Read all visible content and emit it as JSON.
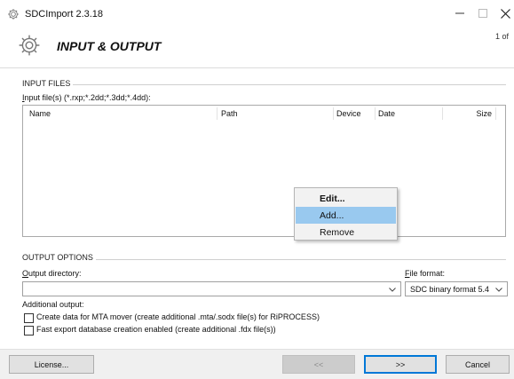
{
  "window": {
    "title": "SDCImport 2.3.18",
    "app_icon": "gear-icon",
    "controls": {
      "minimize_icon": "minimize-icon",
      "maximize_icon": "maximize-icon",
      "close_icon": "close-icon"
    }
  },
  "header": {
    "title": "INPUT & OUTPUT",
    "page_indicator": "1 of",
    "icon": "gear-icon"
  },
  "input_files": {
    "group_label": "INPUT FILES",
    "field_label": "Input file(s) (*.rxp;*.2dd;*.3dd;*.4dd):",
    "columns": [
      "Name",
      "Path",
      "Device",
      "Date",
      "Size"
    ],
    "rows": []
  },
  "context_menu": {
    "items": [
      {
        "label": "Edit...",
        "bold": true,
        "highlighted": false
      },
      {
        "label": "Add...",
        "bold": false,
        "highlighted": true
      },
      {
        "label": "Remove",
        "bold": false,
        "highlighted": false
      }
    ]
  },
  "output_options": {
    "group_label": "OUTPUT OPTIONS",
    "output_directory_label": "Output directory:",
    "output_directory_value": "",
    "file_format_label": "File format:",
    "file_format_value": "SDC binary format 5.4",
    "additional_output_label": "Additional output:",
    "checkboxes": [
      {
        "label": "Create data for MTA mover (create additional .mta/.sodx file(s) for RiPROCESS)",
        "checked": false
      },
      {
        "label": "Fast export database creation enabled (create additional .fdx file(s))",
        "checked": false
      }
    ]
  },
  "footer": {
    "license_label": "License...",
    "back_label": "<<",
    "next_label": ">>",
    "cancel_label": "Cancel"
  },
  "colors": {
    "highlight": "#99c9ef",
    "default_button_border": "#0078d7",
    "disabled_button": "#cccccc"
  }
}
